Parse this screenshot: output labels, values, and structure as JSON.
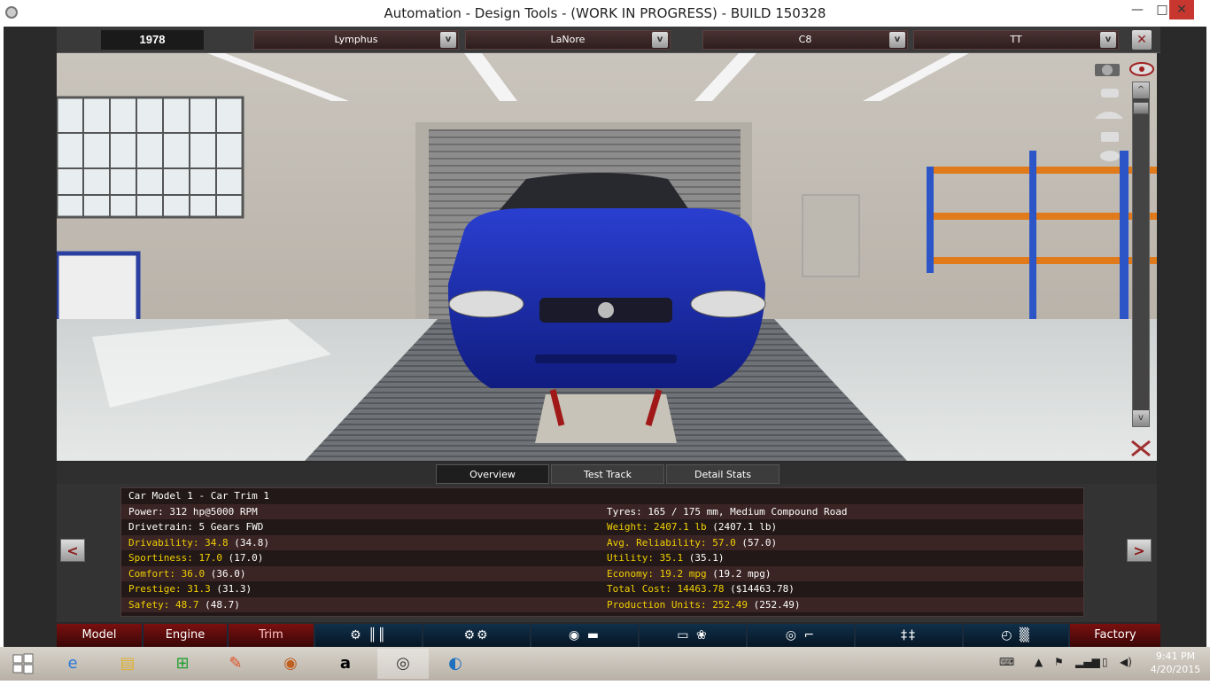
{
  "window": {
    "title": "Automation - Design Tools - (WORK IN PROGRESS) - BUILD 150328",
    "minimize_glyph": "—",
    "maximize_glyph": "□",
    "close_glyph": "✕"
  },
  "header": {
    "year": "1978",
    "make": "Lymphus",
    "model": "LaNore",
    "body": "C8",
    "trim": "TT",
    "dropdown_glyph": "v",
    "close_glyph": "✕"
  },
  "viewport": {
    "scroll_up_glyph": "^",
    "scroll_down_glyph": "v",
    "car_color": "#1e2fb0"
  },
  "tabs": [
    {
      "label": "Overview",
      "active": true
    },
    {
      "label": "Test Track",
      "active": false
    },
    {
      "label": "Detail Stats",
      "active": false
    }
  ],
  "stats": {
    "name": "Car Model 1 - Car Trim 1",
    "power": "Power: 312 hp@5000 RPM",
    "drivetrain": "Drivetrain: 5 Gears FWD",
    "tyres": "Tyres: 165 / 175 mm, Medium Compound Road",
    "left": [
      {
        "label": "Drivability: 34.8",
        "extra": " (34.8)"
      },
      {
        "label": "Sportiness: 17.0",
        "extra": " (17.0)"
      },
      {
        "label": "Comfort: 36.0",
        "extra": " (36.0)"
      },
      {
        "label": "Prestige: 31.3",
        "extra": " (31.3)"
      },
      {
        "label": "Safety: 48.7",
        "extra": " (48.7)"
      }
    ],
    "right": [
      {
        "label": "Weight: 2407.1 lb",
        "extra": " (2407.1 lb)"
      },
      {
        "label": "Avg. Reliability: 57.0",
        "extra": " (57.0)"
      },
      {
        "label": "Utility: 35.1",
        "extra": " (35.1)"
      },
      {
        "label": "Economy: 19.2 mpg",
        "extra": " (19.2 mpg)"
      },
      {
        "label": "Total Cost: 14463.78",
        "extra": " ($14463.78)"
      },
      {
        "label": "Production Units: 252.49",
        "extra": " (252.49)"
      }
    ]
  },
  "nav": {
    "prev_glyph": "<",
    "next_glyph": ">"
  },
  "bottom_nav": [
    {
      "label": "Model"
    },
    {
      "label": "Engine"
    },
    {
      "label": "Trim"
    },
    {
      "icon": "chassis-engine-icon",
      "glyph": "⚙ ║║"
    },
    {
      "icon": "wheels-icon",
      "glyph": "⚙⚙"
    },
    {
      "icon": "drivetrain-icon",
      "glyph": "◉ ▬"
    },
    {
      "icon": "body-aero-icon",
      "glyph": "▭ ❀"
    },
    {
      "icon": "interior-icon",
      "glyph": "◎ ⌐"
    },
    {
      "icon": "suspension-icon",
      "glyph": "‡‡"
    },
    {
      "icon": "test-drive-icon",
      "glyph": "◴ ▒"
    },
    {
      "label": "Factory"
    }
  ],
  "taskbar": {
    "time": "9:41 PM",
    "date": "4/20/2015"
  }
}
